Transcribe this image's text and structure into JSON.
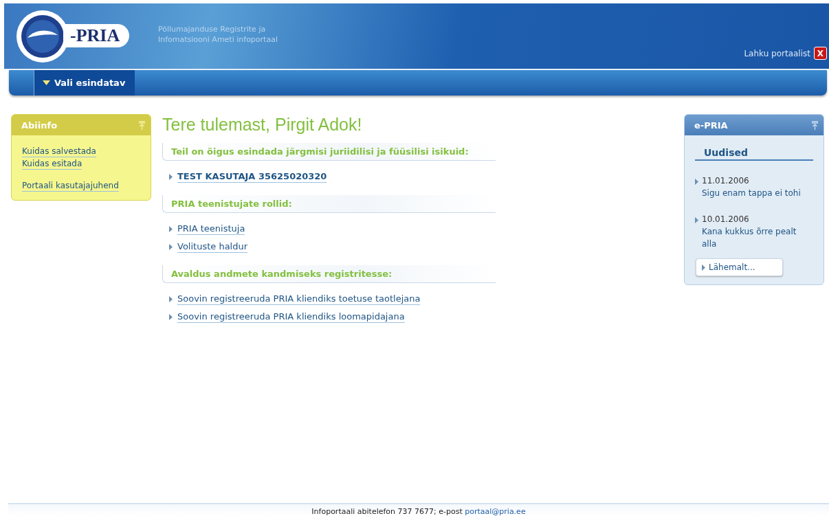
{
  "header": {
    "logo_text": "-PRIA",
    "tagline": [
      "Põllumajanduse Registrite ja",
      "Infomatsiooni Ameti infoportaal"
    ],
    "logout": {
      "label": "Lahku portaalist",
      "icon_text": "X"
    }
  },
  "nav": {
    "items": [
      {
        "label": "Vali esindatav",
        "selected": true
      }
    ]
  },
  "help_panel": {
    "title": "Abiinfo",
    "link_groups": [
      [
        "Kuidas salvestada",
        "Kuidas esitada"
      ],
      [
        "Portaali kasutajajuhend"
      ]
    ]
  },
  "main": {
    "title": "Tere tulemast, Pirgit Adok!",
    "sections": [
      {
        "heading": "Teil on õigus esindada järgmisi juriidilisi ja füüsilisi isikuid:",
        "links": [
          {
            "label": "TEST KASUTAJA 35625020320",
            "bold": true
          }
        ]
      },
      {
        "heading": "PRIA teenistujate rollid:",
        "links": [
          {
            "label": "PRIA teenistuja",
            "bold": false
          },
          {
            "label": "Volituste haldur",
            "bold": false
          }
        ]
      },
      {
        "heading": "Avaldus andmete kandmiseks registritesse:",
        "links": [
          {
            "label": "Soovin registreeruda PRIA kliendiks toetuse taotlejana",
            "bold": false
          },
          {
            "label": "Soovin registreeruda PRIA kliendiks loomapidajana",
            "bold": false
          }
        ]
      }
    ]
  },
  "news_panel": {
    "title": "e-PRIA",
    "heading": "Uudised",
    "items": [
      {
        "date": "11.01.2006",
        "text": "Sigu enam tappa ei tohi"
      },
      {
        "date": "10.01.2006",
        "text": "Kana kukkus õrre pealt alla"
      }
    ],
    "more_button": "Lähemalt..."
  },
  "footer": {
    "text": "Infoportaali abitelefon 737 7677; e-post ",
    "email": "portaal@pria.ee"
  }
}
